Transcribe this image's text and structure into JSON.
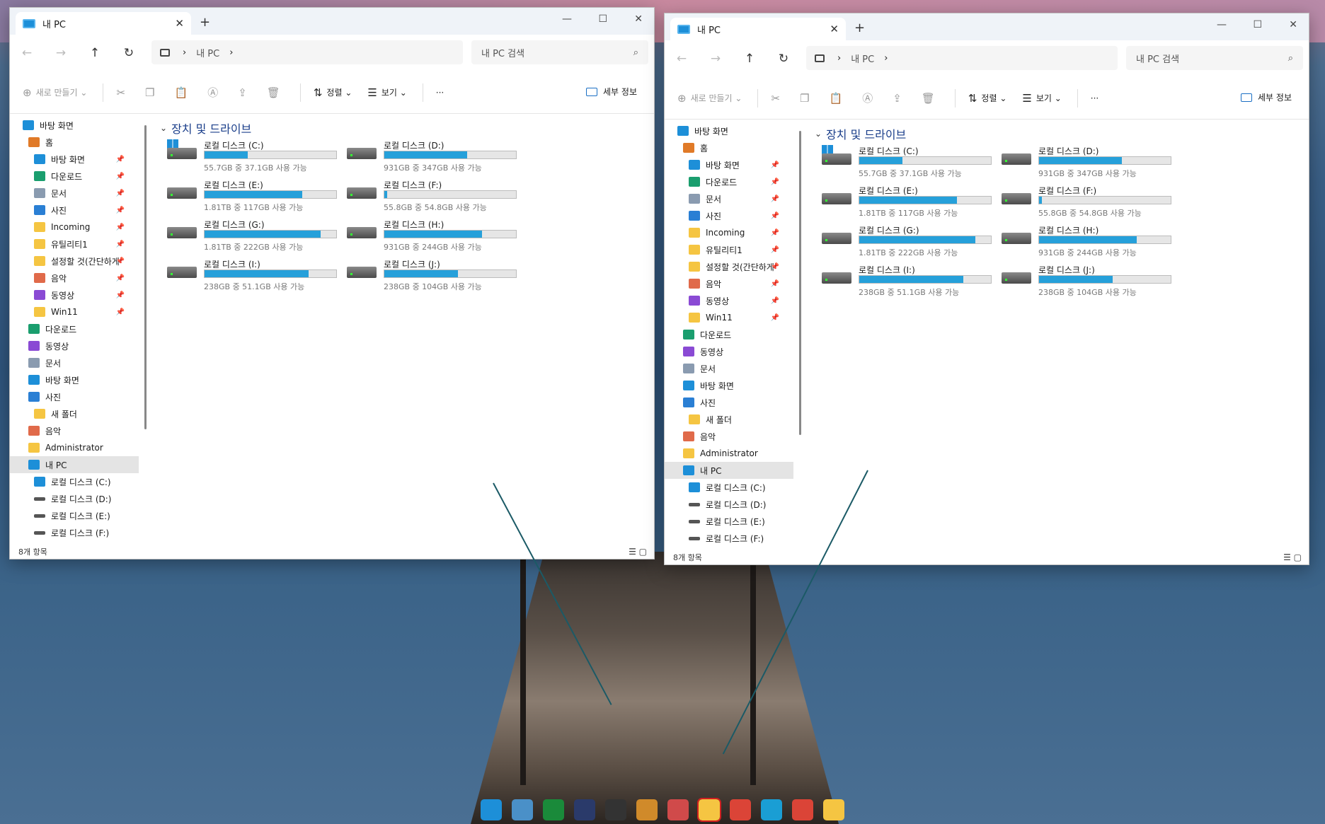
{
  "windows": [
    {
      "tab_title": "내 PC",
      "address": "내 PC",
      "search_placeholder": "내 PC 검색",
      "status": "8개 항목"
    },
    {
      "tab_title": "내 PC",
      "address": "내 PC",
      "search_placeholder": "내 PC 검색",
      "status": "8개 항목"
    }
  ],
  "toolbar": {
    "new": "새로 만들기",
    "sort": "정렬",
    "view": "보기",
    "more": "···",
    "details": "세부 정보"
  },
  "sidebar": [
    {
      "label": "바탕 화면",
      "icon": "desktop-icon",
      "color": "#1d8fd8",
      "indent": 0
    },
    {
      "label": "홈",
      "icon": "home-icon",
      "color": "#e07a28",
      "indent": 1
    },
    {
      "label": "바탕 화면",
      "icon": "desktop-icon",
      "color": "#1d8fd8",
      "indent": 2,
      "pinned": true
    },
    {
      "label": "다운로드",
      "icon": "download-icon",
      "color": "#1a9e6e",
      "indent": 2,
      "pinned": true
    },
    {
      "label": "문서",
      "icon": "document-icon",
      "color": "#8a9bb0",
      "indent": 2,
      "pinned": true
    },
    {
      "label": "사진",
      "icon": "pictures-icon",
      "color": "#2a7fd4",
      "indent": 2,
      "pinned": true
    },
    {
      "label": "Incoming",
      "icon": "folder-icon",
      "color": "#f5c542",
      "indent": 2,
      "pinned": true
    },
    {
      "label": "유틸리티1",
      "icon": "folder-icon",
      "color": "#f5c542",
      "indent": 2,
      "pinned": true
    },
    {
      "label": "설정할 것(간단하게",
      "icon": "folder-icon",
      "color": "#f5c542",
      "indent": 2,
      "pinned": true
    },
    {
      "label": "음악",
      "icon": "music-icon",
      "color": "#e06a4a",
      "indent": 2,
      "pinned": true
    },
    {
      "label": "동영상",
      "icon": "video-icon",
      "color": "#8a4ad4",
      "indent": 2,
      "pinned": true
    },
    {
      "label": "Win11",
      "icon": "folder-icon",
      "color": "#f5c542",
      "indent": 2,
      "pinned": true
    },
    {
      "label": "다운로드",
      "icon": "download-icon",
      "color": "#1a9e6e",
      "indent": 1
    },
    {
      "label": "동영상",
      "icon": "video-icon",
      "color": "#8a4ad4",
      "indent": 1
    },
    {
      "label": "문서",
      "icon": "document-icon",
      "color": "#8a9bb0",
      "indent": 1
    },
    {
      "label": "바탕 화면",
      "icon": "desktop-icon",
      "color": "#1d8fd8",
      "indent": 1
    },
    {
      "label": "사진",
      "icon": "pictures-icon",
      "color": "#2a7fd4",
      "indent": 1
    },
    {
      "label": "새 폴더",
      "icon": "folder-icon",
      "color": "#f5c542",
      "indent": 2
    },
    {
      "label": "음악",
      "icon": "music-icon",
      "color": "#e06a4a",
      "indent": 1
    },
    {
      "label": "Administrator",
      "icon": "folder-icon",
      "color": "#f5c542",
      "indent": 1
    },
    {
      "label": "내 PC",
      "icon": "pc-icon",
      "color": "#1d8fd8",
      "indent": 1,
      "selected": true
    },
    {
      "label": "로컬 디스크 (C:)",
      "icon": "windows-drive-icon",
      "color": "#1d8fd8",
      "indent": 2
    },
    {
      "label": "로컬 디스크 (D:)",
      "icon": "drive-icon",
      "color": "#555555",
      "indent": 2
    },
    {
      "label": "로컬 디스크 (E:)",
      "icon": "drive-icon",
      "color": "#555555",
      "indent": 2
    },
    {
      "label": "로컬 디스크 (F:)",
      "icon": "drive-icon",
      "color": "#555555",
      "indent": 2
    },
    {
      "label": "로컬 디스크 (G:)",
      "icon": "drive-icon",
      "color": "#555555",
      "indent": 2
    }
  ],
  "section_title": "장치 및 드라이브",
  "drives": [
    {
      "name": "로컬 디스크 (C:)",
      "info": "55.7GB 중 37.1GB 사용 가능",
      "used": 0.33,
      "system": true
    },
    {
      "name": "로컬 디스크 (D:)",
      "info": "931GB 중 347GB 사용 가능",
      "used": 0.63
    },
    {
      "name": "로컬 디스크 (E:)",
      "info": "1.81TB 중 117GB 사용 가능",
      "used": 0.74
    },
    {
      "name": "로컬 디스크 (F:)",
      "info": "55.8GB 중 54.8GB 사용 가능",
      "used": 0.02
    },
    {
      "name": "로컬 디스크 (G:)",
      "info": "1.81TB 중 222GB 사용 가능",
      "used": 0.88
    },
    {
      "name": "로컬 디스크 (H:)",
      "info": "931GB 중 244GB 사용 가능",
      "used": 0.74
    },
    {
      "name": "로컬 디스크 (I:)",
      "info": "238GB 중 51.1GB 사용 가능",
      "used": 0.79
    },
    {
      "name": "로컬 디스크 (J:)",
      "info": "238GB 중 104GB 사용 가능",
      "used": 0.56
    }
  ],
  "taskbar": [
    {
      "icon": "windows-start-icon",
      "color": "#1d8fd8"
    },
    {
      "icon": "task-view-icon",
      "color": "#4a90c8"
    },
    {
      "icon": "utorrent-icon",
      "color": "#1a8a3a"
    },
    {
      "icon": "notion-like-icon",
      "color": "#2a3a6a"
    },
    {
      "icon": "calendar-app-icon",
      "color": "#333333"
    },
    {
      "icon": "media-player-icon",
      "color": "#d08a2a"
    },
    {
      "icon": "shape-app-icon",
      "color": "#d04a4a"
    },
    {
      "icon": "file-explorer-icon",
      "color": "#f5c542"
    },
    {
      "icon": "chrome-icon",
      "color": "#db4437"
    },
    {
      "icon": "edge-canary-icon",
      "color": "#1a9ed4"
    },
    {
      "icon": "chrome-icon",
      "color": "#db4437"
    },
    {
      "icon": "file-explorer-icon",
      "color": "#f5c542"
    }
  ]
}
